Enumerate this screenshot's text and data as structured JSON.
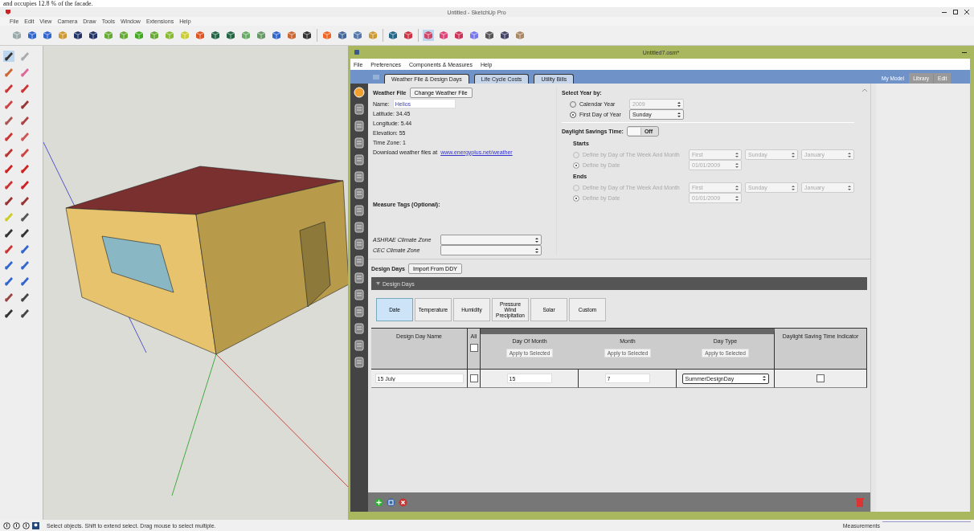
{
  "document_fragment": "and occupies 12.8 % of the facade.",
  "app": {
    "title": "Untitled - SketchUp Pro",
    "menu": [
      "File",
      "Edit",
      "View",
      "Camera",
      "Draw",
      "Tools",
      "Window",
      "Extensions",
      "Help"
    ]
  },
  "plugin": {
    "title": "Untitled7.osm*",
    "menu": [
      "File",
      "Preferences",
      "Components & Measures",
      "Help"
    ],
    "tabs": [
      {
        "label": "Weather File & Design Days",
        "selected": true
      },
      {
        "label": "Life Cycle Costs",
        "selected": false
      },
      {
        "label": "Utility Bills",
        "selected": false
      }
    ],
    "side_tabs": [
      {
        "label": "My Model",
        "selected": true
      },
      {
        "label": "Library",
        "selected": false
      },
      {
        "label": "Edit",
        "selected": false
      }
    ],
    "weather": {
      "heading": "Weather File",
      "change_button": "Change Weather File",
      "name_label": "Name:",
      "name_value": "Helios",
      "lines": [
        "Latitude: 34.45",
        "Longitude: 5.44",
        "Elevation: 55",
        "Time Zone: 1"
      ],
      "download_text": "Download weather files at",
      "download_link": "www.energyplus.net/weather"
    },
    "measure_tags": {
      "heading": "Measure Tags (Optional):",
      "fields": [
        {
          "label": "ASHRAE Climate Zone"
        },
        {
          "label": "CEC Climate Zone"
        }
      ]
    },
    "year": {
      "heading": "Select Year by:",
      "options": [
        {
          "label": "Calendar Year",
          "selected": false,
          "value": "2009"
        },
        {
          "label": "First Day of Year",
          "selected": true,
          "value": "Sunday"
        }
      ]
    },
    "dst": {
      "label": "Daylight Savings Time:",
      "toggle_text": "Off",
      "on": false,
      "groups": [
        {
          "heading": "Starts",
          "options": [
            {
              "label": "Define by Day of The Week And Month",
              "selected": false,
              "values": [
                "First",
                "Sunday",
                "January"
              ]
            },
            {
              "label": "Define by Date",
              "selected": true,
              "values": [
                "01/01/2009"
              ]
            }
          ]
        },
        {
          "heading": "Ends",
          "options": [
            {
              "label": "Define by Day of The Week And Month",
              "selected": false,
              "values": [
                "First",
                "Sunday",
                "January"
              ]
            },
            {
              "label": "Define by Date",
              "selected": true,
              "values": [
                "01/01/2009"
              ]
            }
          ]
        }
      ]
    },
    "design_days": {
      "heading": "Design Days",
      "import_button": "Import From DDY",
      "section_title": "Design Days",
      "subtabs": [
        {
          "label": "Date",
          "selected": true
        },
        {
          "label": "Temperature",
          "selected": false
        },
        {
          "label": "Humidity",
          "selected": false
        },
        {
          "label": "Pressure Wind Precipitation",
          "selected": false
        },
        {
          "label": "Solar",
          "selected": false
        },
        {
          "label": "Custom",
          "selected": false
        }
      ],
      "columns": [
        {
          "kind": "name",
          "label": "Design Day Name"
        },
        {
          "kind": "all",
          "label": "All",
          "checked": false
        },
        {
          "kind": "field",
          "label": "Day Of Month",
          "apply": "Apply to Selected"
        },
        {
          "kind": "field",
          "label": "Month",
          "apply": "Apply to Selected"
        },
        {
          "kind": "select",
          "label": "Day Type",
          "apply": "Apply to Selected"
        },
        {
          "kind": "check",
          "label": "Daylight Saving Time Indicator"
        }
      ],
      "rows": [
        {
          "cells": [
            {
              "value": "15 July"
            },
            {
              "checked": false
            },
            {
              "value": "15"
            },
            {
              "value": "7"
            },
            {
              "value": "SummerDesignDay"
            },
            {
              "checked": false
            }
          ]
        }
      ]
    }
  },
  "status": {
    "text": "Select objects. Shift to extend select. Drag mouse to select multiple.",
    "measurements": "Measurements"
  }
}
